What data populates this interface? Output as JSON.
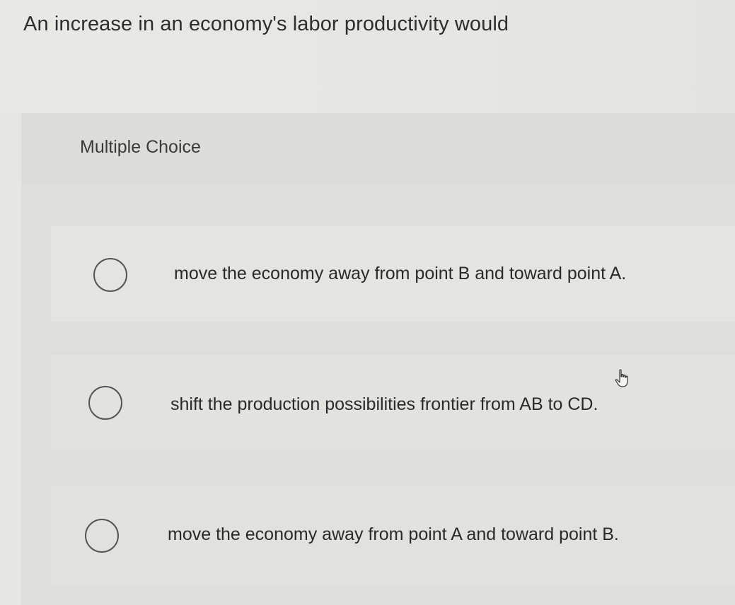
{
  "question": {
    "prompt": "An increase in an economy's labor productivity would"
  },
  "choices_section": {
    "heading": "Multiple Choice",
    "options": [
      {
        "label": "move the economy away from point B and toward point A.",
        "selected": false
      },
      {
        "label": "shift the production possibilities frontier from AB to CD.",
        "selected": false
      },
      {
        "label": "move the economy away from point A and toward point B.",
        "selected": false
      }
    ]
  },
  "cursor": {
    "icon": "hand-pointer-icon"
  },
  "colors": {
    "background": "#e6e6e3",
    "panel": "#dededb",
    "text": "#2b2b2b",
    "radio_border": "#555555"
  }
}
